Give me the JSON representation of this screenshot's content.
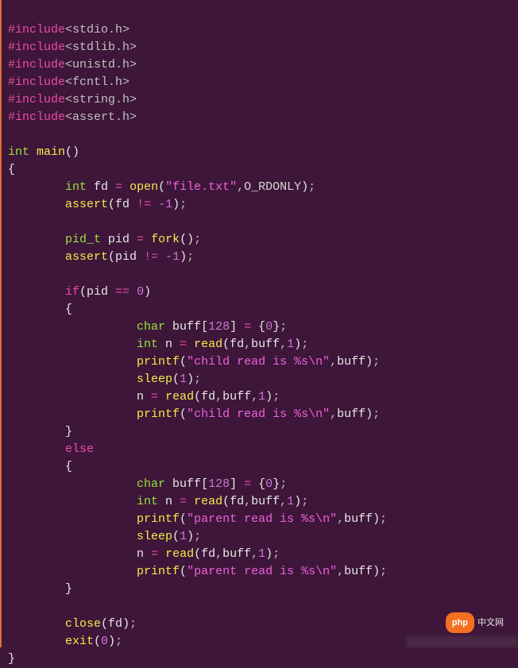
{
  "includes": [
    {
      "dir": "#include",
      "hdr": "<stdio.h>"
    },
    {
      "dir": "#include",
      "hdr": "<stdlib.h>"
    },
    {
      "dir": "#include",
      "hdr": "<unistd.h>"
    },
    {
      "dir": "#include",
      "hdr": "<fcntl.h>"
    },
    {
      "dir": "#include",
      "hdr": "<string.h>"
    },
    {
      "dir": "#include",
      "hdr": "<assert.h>"
    }
  ],
  "sig": {
    "ret": "int",
    "name": "main",
    "params": "()"
  },
  "l1": {
    "t1": "int",
    "v": " fd ",
    "eq": "=",
    "fn": " open",
    "p": "(",
    "s": "\"file.txt\"",
    "c": ",",
    "m": "O_RDONLY",
    "p2": ")",
    "sc": ";"
  },
  "l2": {
    "fn": "assert",
    "p": "(",
    "e": "fd ",
    "op": "!=",
    "n": " -1",
    "p2": ")",
    "sc": ";"
  },
  "l3": {
    "t": "pid_t",
    "v": " pid ",
    "eq": "=",
    "fn": " fork",
    "p": "()",
    "sc": ";"
  },
  "l4": {
    "fn": "assert",
    "p": "(",
    "e": "pid ",
    "op": "!=",
    "n": " -1",
    "p2": ")",
    "sc": ";"
  },
  "if": {
    "kw": "if",
    "p": "(",
    "e": "pid ",
    "op": "==",
    "n": " 0",
    "p2": ")"
  },
  "b1": {
    "t": "char",
    "v": " buff",
    "br": "[",
    "n": "128",
    "br2": "]",
    "sp": " ",
    "eq": "=",
    "sp2": " ",
    "br3": "{",
    "z": "0",
    "br4": "}",
    "sc": ";"
  },
  "b2": {
    "t": "int",
    "v": " n ",
    "eq": "=",
    "fn": " read",
    "p": "(",
    "a": "fd",
    "c1": ",",
    "a2": "buff",
    "c2": ",",
    "n": "1",
    "p2": ")",
    "sc": ";"
  },
  "b3": {
    "fn": "printf",
    "p": "(",
    "s": "\"child read is %s\\n\"",
    "c": ",",
    "a": "buff",
    "p2": ")",
    "sc": ";"
  },
  "b4": {
    "fn": "sleep",
    "p": "(",
    "n": "1",
    "p2": ")",
    "sc": ";"
  },
  "b5": {
    "v": "n ",
    "eq": "=",
    "fn": " read",
    "p": "(",
    "a": "fd",
    "c1": ",",
    "a2": "buff",
    "c2": ",",
    "n": "1",
    "p2": ")",
    "sc": ";"
  },
  "b6": {
    "fn": "printf",
    "p": "(",
    "s": "\"child read is %s\\n\"",
    "c": ",",
    "a": "buff",
    "p2": ")",
    "sc": ";"
  },
  "else": "else",
  "e1": {
    "t": "char",
    "v": " buff",
    "br": "[",
    "n": "128",
    "br2": "]",
    "sp": " ",
    "eq": "=",
    "sp2": " ",
    "br3": "{",
    "z": "0",
    "br4": "}",
    "sc": ";"
  },
  "e2": {
    "t": "int",
    "v": " n ",
    "eq": "=",
    "fn": " read",
    "p": "(",
    "a": "fd",
    "c1": ",",
    "a2": "buff",
    "c2": ",",
    "n": "1",
    "p2": ")",
    "sc": ";"
  },
  "e3": {
    "fn": "printf",
    "p": "(",
    "s": "\"parent read is %s\\n\"",
    "c": ",",
    "a": "buff",
    "p2": ")",
    "sc": ";"
  },
  "e4": {
    "fn": "sleep",
    "p": "(",
    "n": "1",
    "p2": ")",
    "sc": ";"
  },
  "e5": {
    "v": "n ",
    "eq": "=",
    "fn": " read",
    "p": "(",
    "a": "fd",
    "c1": ",",
    "a2": "buff",
    "c2": ",",
    "n": "1",
    "p2": ")",
    "sc": ";"
  },
  "e6": {
    "fn": "printf",
    "p": "(",
    "s": "\"parent read is %s\\n\"",
    "c": ",",
    "a": "buff",
    "p2": ")",
    "sc": ";"
  },
  "cl": {
    "fn": "close",
    "p": "(",
    "a": "fd",
    "p2": ")",
    "sc": ";"
  },
  "ex": {
    "fn": "exit",
    "p": "(",
    "n": "0",
    "p2": ")",
    "sc": ";"
  },
  "braces": {
    "o": "{",
    "c": "}"
  },
  "badge": {
    "pill": "php",
    "text": "中文网"
  },
  "indent": {
    "i1": "        ",
    "i2": "                  ",
    "i0": ""
  }
}
